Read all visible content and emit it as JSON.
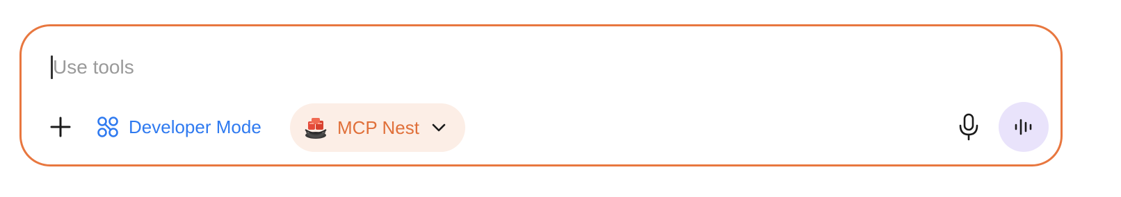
{
  "composer": {
    "placeholder": "Use tools",
    "value": "",
    "accent_color": "#E8773F"
  },
  "toolbar": {
    "add_icon": "plus-icon",
    "developer_mode": {
      "label": "Developer Mode",
      "icon": "nodes-icon",
      "color": "#2F7AF0"
    },
    "mcp_chip": {
      "label": "MCP Nest",
      "icon": "nest-logo-icon",
      "dropdown_icon": "chevron-down-icon",
      "color": "#E0703A",
      "background": "#FCEEE6"
    },
    "mic_icon": "microphone-icon",
    "voice_icon": "voice-waveform-icon",
    "voice_background": "#E9E3FB"
  }
}
